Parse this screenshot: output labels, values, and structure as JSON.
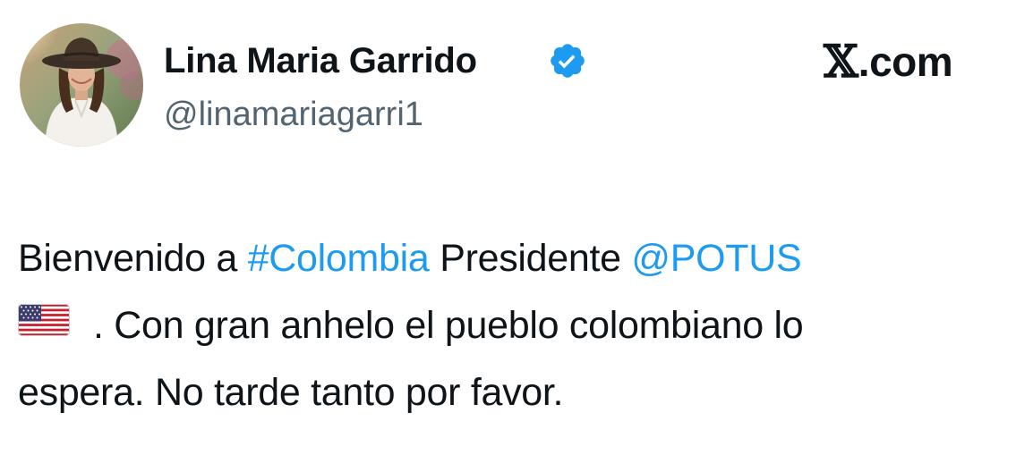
{
  "user": {
    "display_name": "Lina Maria Garrido",
    "handle": "@linamariagarri1",
    "verified_icon": "verified-badge-icon",
    "verified_color": "#1d9bf0"
  },
  "brand": {
    "x_glyph": "𝕏",
    "domain_text": ".com"
  },
  "tweet": {
    "line1_text_a": "Bienvenido a ",
    "hashtag": "#Colombia",
    "line1_text_b": " Presidente ",
    "mention": "@POTUS",
    "flag_icon": "us-flag-icon",
    "line2_text": ". Con gran anhelo el pueblo colombiano lo",
    "line3_text": "espera. No tarde tanto por favor."
  },
  "colors": {
    "link": "#1d9bf0",
    "text": "#0f1419",
    "secondary_text": "#536471"
  }
}
